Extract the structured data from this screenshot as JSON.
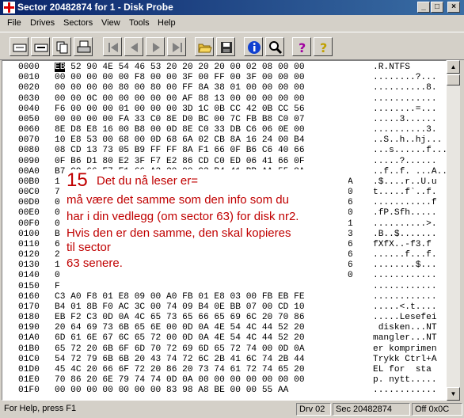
{
  "window": {
    "title": "Sector 20482874 for 1 - Disk Probe",
    "minimize": "_",
    "maximize": "□",
    "close": "×"
  },
  "menu": [
    "File",
    "Drives",
    "Sectors",
    "View",
    "Tools",
    "Help"
  ],
  "toolbar": {
    "buttons": [
      "read-icon",
      "write-icon",
      "copy-icon",
      "print-icon",
      "first-icon",
      "prev-icon",
      "next-icon",
      "last-icon",
      "open-icon",
      "save-icon",
      "info-icon",
      "search-icon",
      "help-icon",
      "context-help-icon"
    ]
  },
  "hex_rows": [
    {
      "offset": "0000",
      "first": "EB",
      "rest": " 52 90 4E 54 46 53 20 20 20 20 00 02 08 00 00",
      "ascii": ".R.NTFS"
    },
    {
      "offset": "0010",
      "hex": "00 00 00 00 00 F8 00 00 3F 00 FF 00 3F 00 00 00",
      "ascii": "........?..."
    },
    {
      "offset": "0020",
      "hex": "00 00 00 00 80 00 80 00 FF 8A 38 01 00 00 00 00",
      "ascii": "..........8."
    },
    {
      "offset": "0030",
      "hex": "00 00 0C 00 00 00 00 00 AF 88 13 00 00 00 00 00",
      "ascii": "............"
    },
    {
      "offset": "0040",
      "hex": "F6 00 00 00 01 00 00 00 3D 1C 0B CC 42 0B CC 56",
      "ascii": "........=..."
    },
    {
      "offset": "0050",
      "hex": "00 00 00 00 FA 33 C0 8E D0 BC 00 7C FB B8 C0 07",
      "ascii": ".....3......"
    },
    {
      "offset": "0060",
      "hex": "8E D8 E8 16 00 B8 00 0D 8E C0 33 DB C6 06 0E 00",
      "ascii": "..........3."
    },
    {
      "offset": "0070",
      "hex": "10 E8 53 00 68 00 0D 68 6A 02 CB 8A 16 24 00 B4",
      "ascii": "..S..h..hj..."
    },
    {
      "offset": "0080",
      "hex": "08 CD 13 73 05 B9 FF FF 8A F1 66 0F B6 C6 40 66",
      "ascii": "...s......f..."
    },
    {
      "offset": "0090",
      "hex": "0F B6 D1 80 E2 3F F7 E2 86 CD C0 ED 06 41 66 0F",
      "ascii": ".....?......"
    },
    {
      "offset": "00A0",
      "hex": "B7 C9 66 F7 E1 66 A3 20 00 C3 B4 41 BB AA 55 8A",
      "ascii": "..f..f. ...A..U."
    },
    {
      "offset": "00B0",
      "left": "1",
      "right": "A",
      "ascii": ".$....r..U.u"
    },
    {
      "offset": "00C0",
      "left": "7",
      "right": "0",
      "ascii": "t.....f`..f."
    },
    {
      "offset": "00D0",
      "left": "0",
      "right": "6",
      "ascii": "...........f"
    },
    {
      "offset": "00E0",
      "left": "0",
      "right": "0",
      "ascii": ".fP.Sfh....."
    },
    {
      "offset": "00F0",
      "left": "0",
      "right": "1",
      "ascii": "..........>."
    },
    {
      "offset": "0100",
      "left": "B",
      "right": "3",
      "ascii": ".B..$......."
    },
    {
      "offset": "0110",
      "left": "6",
      "right": "6",
      "ascii": "fXfX..-f3.f"
    },
    {
      "offset": "0120",
      "left": "2",
      "right": "6",
      "ascii": "......f...f."
    },
    {
      "offset": "0130",
      "left": "1",
      "right": "6",
      "ascii": "........$..."
    },
    {
      "offset": "0140",
      "left": "0",
      "right": "0",
      "ascii": "............"
    },
    {
      "offset": "0150",
      "left": "F",
      "right": "",
      "ascii": "............"
    },
    {
      "offset": "0160",
      "hex": "C3 A0 F8 01 E8 09 00 A0 FB 01 E8 03 00 FB EB FE",
      "ascii": "............"
    },
    {
      "offset": "0170",
      "hex": "B4 01 8B F0 AC 3C 00 74 09 B4 0E BB 07 00 CD 10",
      "ascii": ".....<.t...."
    },
    {
      "offset": "0180",
      "hex": "EB F2 C3 0D 0A 4C 65 73 65 66 65 69 6C 20 70 86",
      "ascii": ".....Lesefei"
    },
    {
      "offset": "0190",
      "hex": "20 64 69 73 6B 65 6E 00 0D 0A 4E 54 4C 44 52 20",
      "ascii": " disken...NT"
    },
    {
      "offset": "01A0",
      "hex": "6D 61 6E 67 6C 65 72 00 0D 0A 4E 54 4C 44 52 20",
      "ascii": "mangler...NT"
    },
    {
      "offset": "01B0",
      "hex": "65 72 20 6B 6F 6D 70 72 69 6D 65 72 74 00 0D 0A",
      "ascii": "er komprimen"
    },
    {
      "offset": "01C0",
      "hex": "54 72 79 6B 6B 20 43 74 72 6C 2B 41 6C 74 2B 44",
      "ascii": "Trykk Ctrl+A"
    },
    {
      "offset": "01D0",
      "hex": "45 4C 20 66 6F 72 20 86 20 73 74 61 72 74 65 20",
      "ascii": "EL for  sta"
    },
    {
      "offset": "01E0",
      "hex": "70 86 20 6E 79 74 74 0D 0A 00 00 00 00 00 00 00",
      "ascii": "p. nytt....."
    },
    {
      "offset": "01F0",
      "hex": "00 00 00 00 00 00 00 83 98 A8 BE 00 00 55 AA",
      "ascii": "............"
    }
  ],
  "overlay": {
    "number": "15",
    "line1": "Det du nå leser er=",
    "line2": "må være det samme som den info som du",
    "line3": "har i din vedlegg (om sector 63) for disk nr2.",
    "line4": "Hvis den er den samme, den skal kopieres",
    "line5": "til sector",
    "line6": "63 senere."
  },
  "status": {
    "help": "For Help, press F1",
    "drive": "Drv  02",
    "sector": "Sec 20482874",
    "offset": "Off 0x0C"
  },
  "colors": {
    "title_start": "#0a246a",
    "title_end": "#3a6ea5",
    "annotation": "#c00000"
  }
}
